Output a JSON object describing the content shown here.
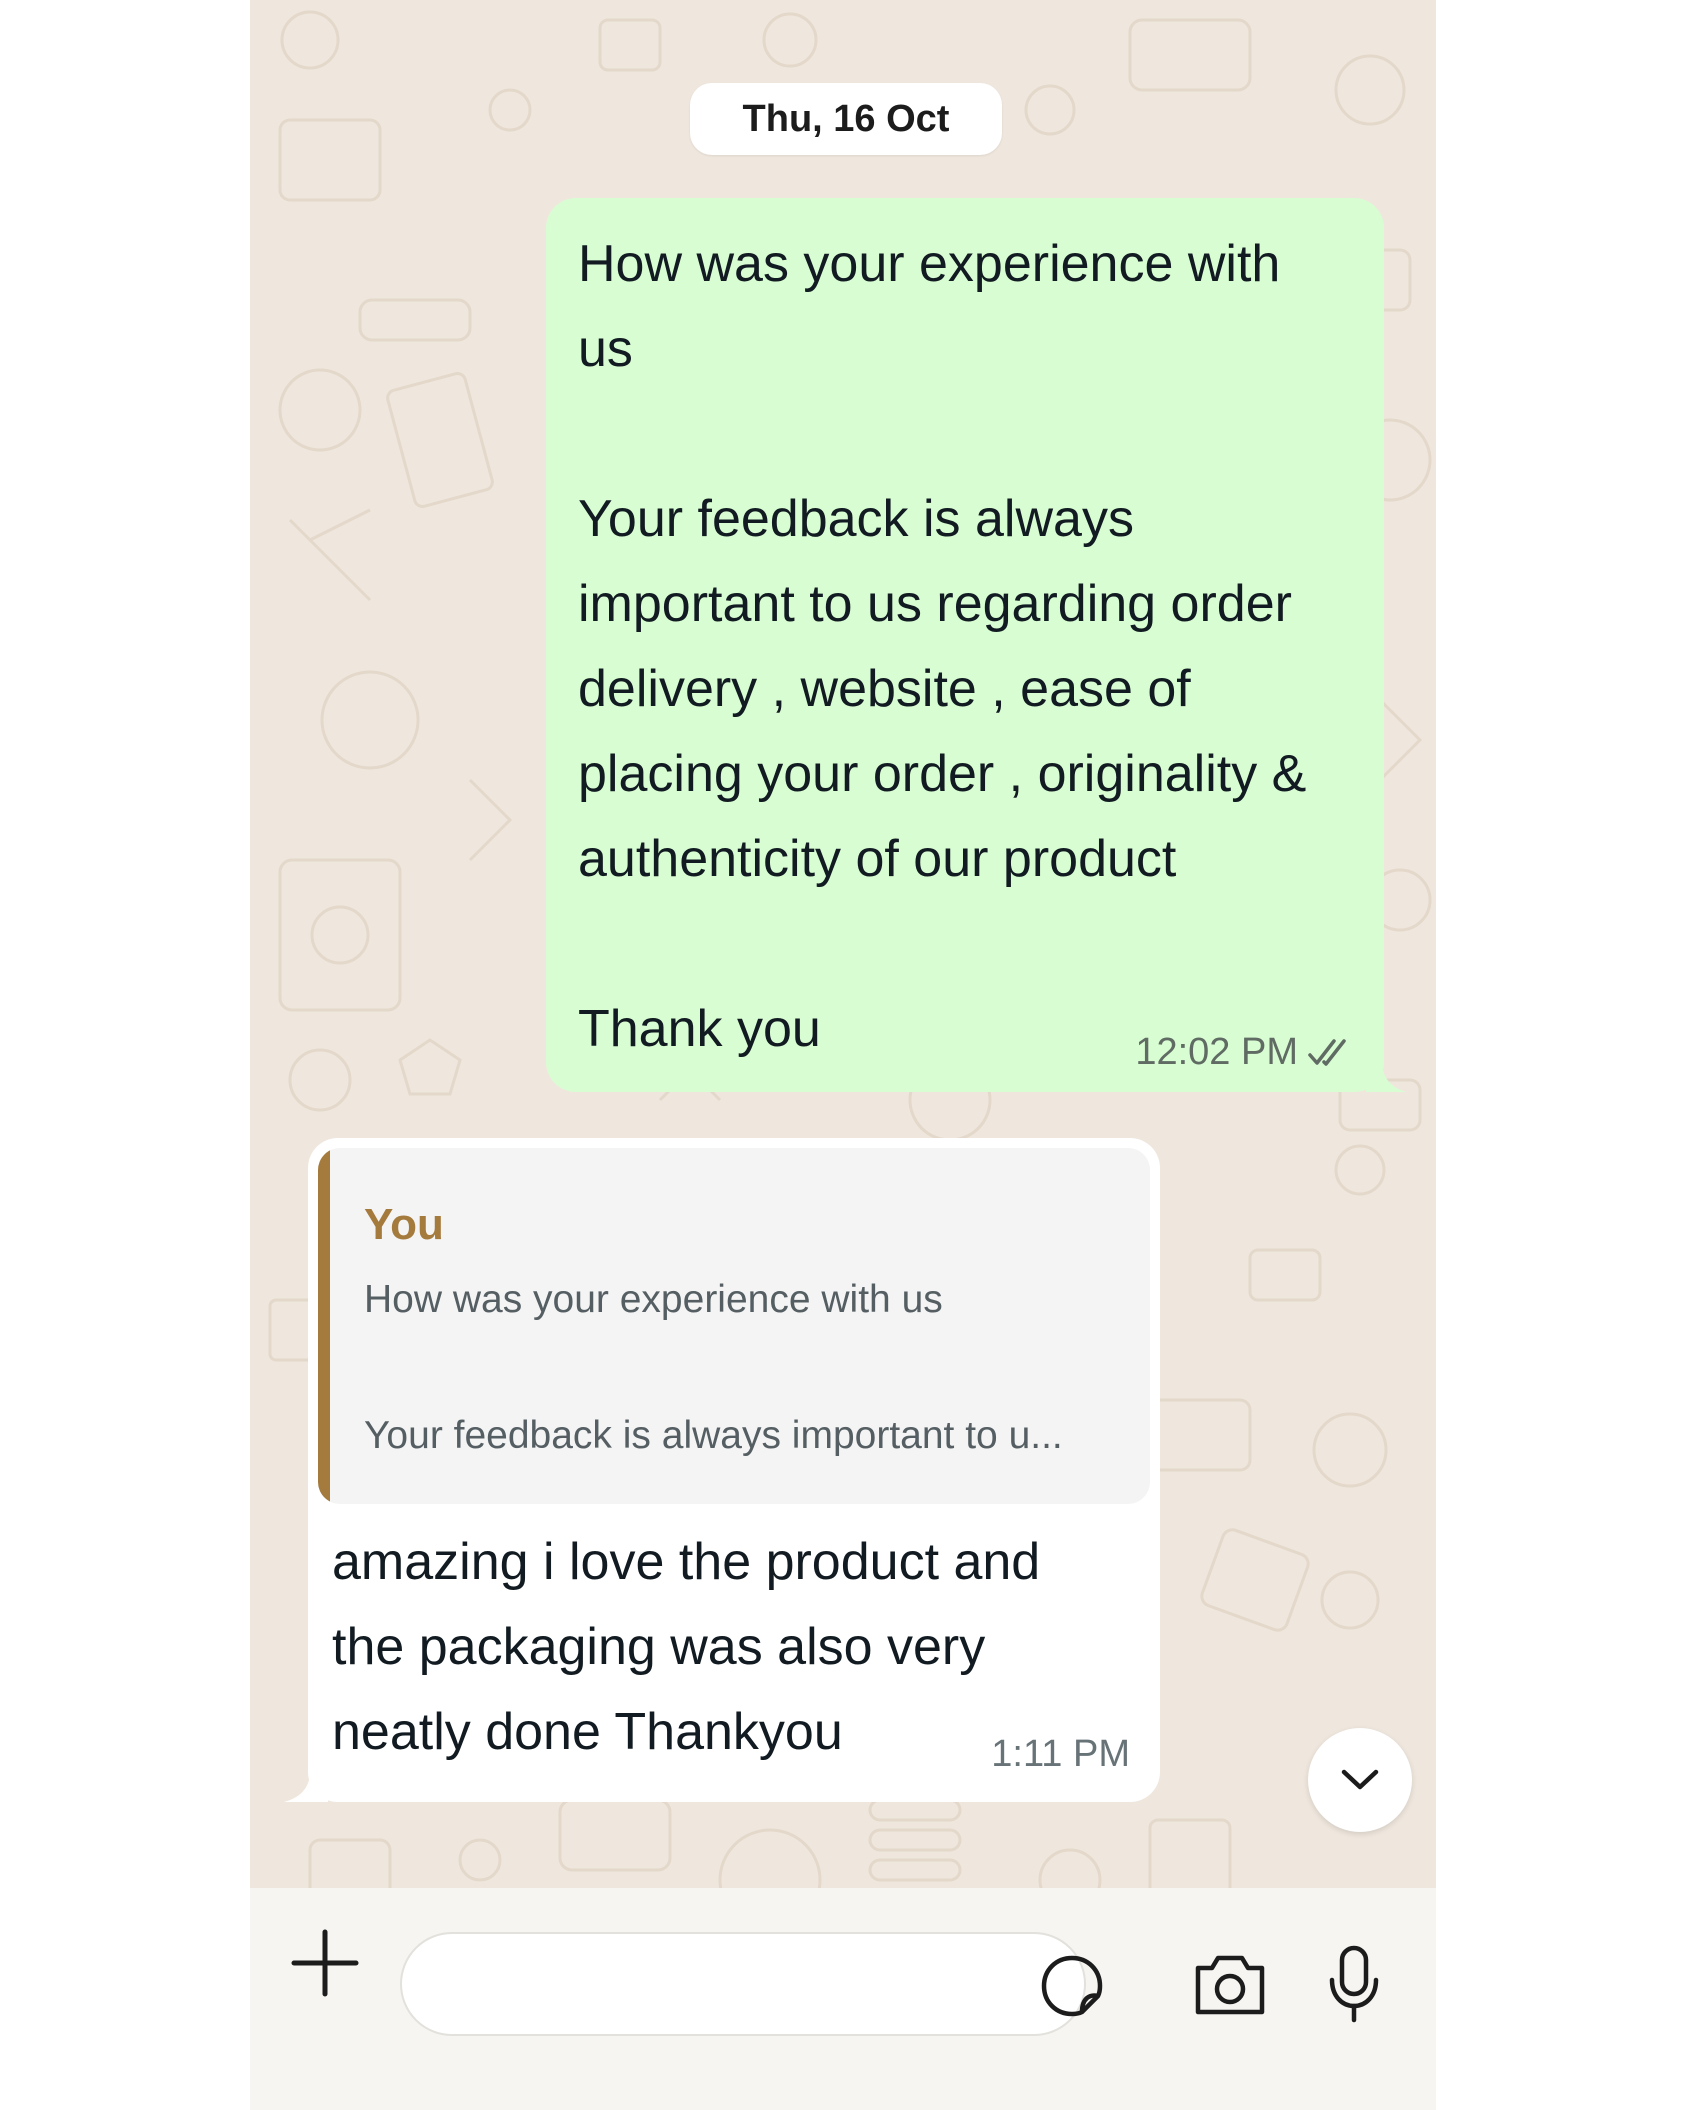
{
  "chat": {
    "date_separator": "Thu, 16 Oct",
    "outgoing_message": {
      "text": "How was your experience with\nus\n\nYour feedback is always\nimportant to us regarding order\ndelivery , website , ease of\nplacing your order , originality &\nauthenticity of our product\n\nThank you",
      "time": "12:02 PM",
      "status": "read",
      "status_icon": "double-check-icon"
    },
    "incoming_message": {
      "quoted_author": "You",
      "quoted_line_1": "How was your experience with us",
      "quoted_line_2": "Your feedback is always important to u...",
      "text": "amazing i love the product and the packaging was also very neatly done Thankyou",
      "time": "1:11 PM"
    }
  },
  "composer": {
    "attach_icon": "plus-icon",
    "input_value": "",
    "sticker_icon": "sticker-icon",
    "camera_icon": "camera-icon",
    "mic_icon": "microphone-icon"
  },
  "scroll_button_icon": "chevron-down-icon",
  "colors": {
    "wallpaper": "#efe7dd",
    "outgoing_bubble": "#d9fdd3",
    "incoming_bubble": "#ffffff",
    "quote_accent": "#a57a3d",
    "read_tick": "#5f6b63"
  }
}
